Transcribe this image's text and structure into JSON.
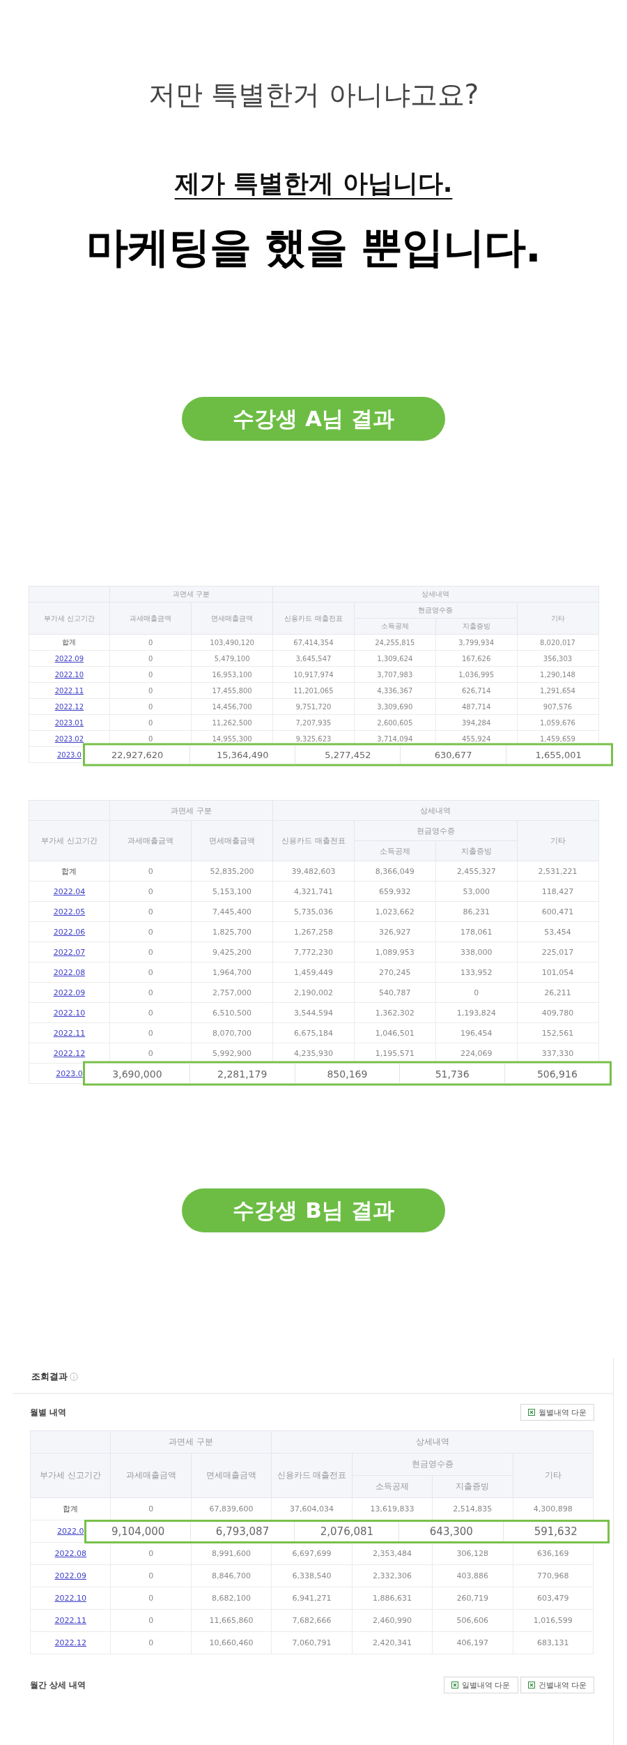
{
  "headline": {
    "question": "저만 특별한거 아니냐고요?",
    "answer": "제가 특별한게 아닙니다.",
    "emphasis": "마케팅을 했을 뿐입니다."
  },
  "result_a": {
    "badge": "수강생 A님 결과",
    "tables": [
      {
        "headers": {
          "tax_group": "과면세 구분",
          "detail_group": "상세내역",
          "period": "부가세 신고기간",
          "taxable": "과세매출금액",
          "exempt": "면세매출금액",
          "card": "신용카드 매출전표",
          "cash_group": "현금영수증",
          "income": "소득공제",
          "expense": "지출증빙",
          "other": "기타"
        },
        "rows": [
          {
            "kind": "total",
            "period": "합계",
            "cells": [
              "0",
              "103,490,120",
              "67,414,354",
              "24,255,815",
              "3,799,934",
              "8,020,017"
            ]
          },
          {
            "kind": "month",
            "period": "2022.09",
            "cells": [
              "0",
              "5,479,100",
              "3,645,547",
              "1,309,624",
              "167,626",
              "356,303"
            ]
          },
          {
            "kind": "month",
            "period": "2022.10",
            "cells": [
              "0",
              "16,953,100",
              "10,917,974",
              "3,707,983",
              "1,036,995",
              "1,290,148"
            ]
          },
          {
            "kind": "month",
            "period": "2022.11",
            "cells": [
              "0",
              "17,455,800",
              "11,201,065",
              "4,336,367",
              "626,714",
              "1,291,654"
            ]
          },
          {
            "kind": "month",
            "period": "2022.12",
            "cells": [
              "0",
              "14,456,700",
              "9,751,720",
              "3,309,690",
              "487,714",
              "907,576"
            ]
          },
          {
            "kind": "month",
            "period": "2023.01",
            "cells": [
              "0",
              "11,262,500",
              "7,207,935",
              "2,600,605",
              "394,284",
              "1,059,676"
            ]
          },
          {
            "kind": "month",
            "period": "2023.02",
            "cells": [
              "0",
              "14,955,300",
              "9,325,623",
              "3,714,094",
              "455,924",
              "1,459,659"
            ]
          },
          {
            "kind": "month",
            "period": "2023.0",
            "highlight": [
              "22,927,620",
              "15,364,490",
              "5,277,452",
              "630,677",
              "1,655,001"
            ]
          }
        ]
      },
      {
        "headers": {
          "tax_group": "과면세 구분",
          "detail_group": "상세내역",
          "period": "부가세 신고기간",
          "taxable": "과세매출금액",
          "exempt": "면세매출금액",
          "card": "신용카드 매출전표",
          "cash_group": "현금영수증",
          "income": "소득공제",
          "expense": "지출증빙",
          "other": "기타"
        },
        "rows": [
          {
            "kind": "total",
            "period": "합계",
            "cells": [
              "0",
              "52,835,200",
              "39,482,603",
              "8,366,049",
              "2,455,327",
              "2,531,221"
            ]
          },
          {
            "kind": "month",
            "period": "2022.04",
            "cells": [
              "0",
              "5,153,100",
              "4,321,741",
              "659,932",
              "53,000",
              "118,427"
            ]
          },
          {
            "kind": "month",
            "period": "2022.05",
            "cells": [
              "0",
              "7,445,400",
              "5,735,036",
              "1,023,662",
              "86,231",
              "600,471"
            ]
          },
          {
            "kind": "month",
            "period": "2022.06",
            "cells": [
              "0",
              "1,825,700",
              "1,267,258",
              "326,927",
              "178,061",
              "53,454"
            ]
          },
          {
            "kind": "month",
            "period": "2022.07",
            "cells": [
              "0",
              "9,425,200",
              "7,772,230",
              "1,089,953",
              "338,000",
              "225,017"
            ]
          },
          {
            "kind": "month",
            "period": "2022.08",
            "cells": [
              "0",
              "1,964,700",
              "1,459,449",
              "270,245",
              "133,952",
              "101,054"
            ]
          },
          {
            "kind": "month",
            "period": "2022.09",
            "cells": [
              "0",
              "2,757,000",
              "2,190,002",
              "540,787",
              "0",
              "26,211"
            ]
          },
          {
            "kind": "month",
            "period": "2022.10",
            "cells": [
              "0",
              "6,510,500",
              "3,544,594",
              "1,362,302",
              "1,193,824",
              "409,780"
            ]
          },
          {
            "kind": "month",
            "period": "2022.11",
            "cells": [
              "0",
              "8,070,700",
              "6,675,184",
              "1,046,501",
              "196,454",
              "152,561"
            ]
          },
          {
            "kind": "month",
            "period": "2022.12",
            "cells": [
              "0",
              "5,992,900",
              "4,235,930",
              "1,195,571",
              "224,069",
              "337,330"
            ]
          },
          {
            "kind": "month",
            "period": "2023.0",
            "highlight": [
              "3,690,000",
              "2,281,179",
              "850,169",
              "51,736",
              "506,916"
            ]
          }
        ]
      }
    ]
  },
  "result_b": {
    "badge": "수강생 B님 결과",
    "panel_title": "조회결과",
    "monthly_title": "월별 내역",
    "monthly_button": "월별내역 다운",
    "table": {
      "headers": {
        "tax_group": "과면세 구분",
        "detail_group": "상세내역",
        "period": "부가세 신고기간",
        "taxable": "과세매출금액",
        "exempt": "면세매출금액",
        "card": "신용카드 매출전표",
        "cash_group": "현금영수증",
        "income": "소득공제",
        "expense": "지출증빙",
        "other": "기타"
      },
      "rows": [
        {
          "kind": "total",
          "period": "합계",
          "cells": [
            "0",
            "67,839,600",
            "37,604,034",
            "13,619,833",
            "2,514,835",
            "4,300,898"
          ]
        },
        {
          "kind": "month",
          "period": "2022.0",
          "highlight": [
            "9,104,000",
            "6,793,087",
            "2,076,081",
            "643,300",
            "591,632"
          ]
        },
        {
          "kind": "month",
          "period": "2022.08",
          "cells": [
            "0",
            "8,991,600",
            "6,697,699",
            "2,353,484",
            "306,128",
            "636,169"
          ]
        },
        {
          "kind": "month",
          "period": "2022.09",
          "cells": [
            "0",
            "8,846,700",
            "6,338,540",
            "2,332,306",
            "403,886",
            "770,968"
          ]
        },
        {
          "kind": "month",
          "period": "2022.10",
          "cells": [
            "0",
            "8,682,100",
            "6,941,271",
            "1,886,631",
            "260,719",
            "603,479"
          ]
        },
        {
          "kind": "month",
          "period": "2022.11",
          "cells": [
            "0",
            "11,665,860",
            "7,682,666",
            "2,460,990",
            "506,606",
            "1,016,599"
          ]
        },
        {
          "kind": "month",
          "period": "2022.12",
          "cells": [
            "0",
            "10,660,460",
            "7,060,791",
            "2,420,341",
            "406,197",
            "683,131"
          ]
        }
      ]
    },
    "detail_title": "월간 상세 내역",
    "detail_buttons": [
      "일별내역 다운",
      "건별내역 다운"
    ]
  }
}
